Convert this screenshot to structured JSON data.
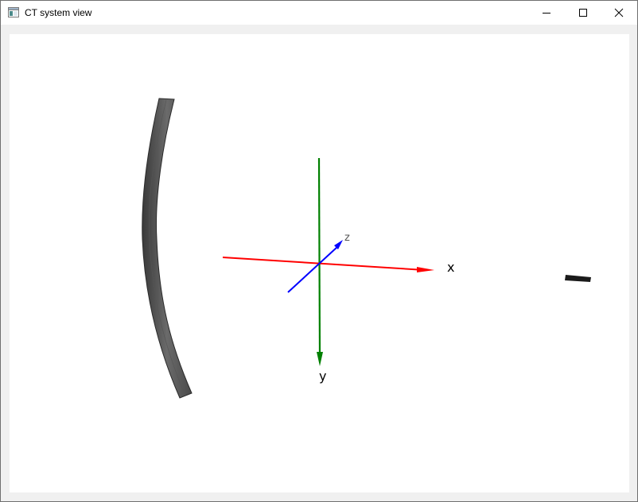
{
  "window": {
    "title": "CT system view",
    "icon": "app-window-icon",
    "controls": {
      "minimize": "minimize-icon",
      "maximize": "maximize-icon",
      "close": "close-icon"
    }
  },
  "scene": {
    "axes": {
      "x": {
        "label": "x",
        "color": "#ff0000"
      },
      "y": {
        "label": "y",
        "color": "#008000"
      },
      "z": {
        "label": "z",
        "color": "#0000ff"
      }
    },
    "detector_color": "#5a5a5a",
    "source_color": "#1a1a1a"
  }
}
